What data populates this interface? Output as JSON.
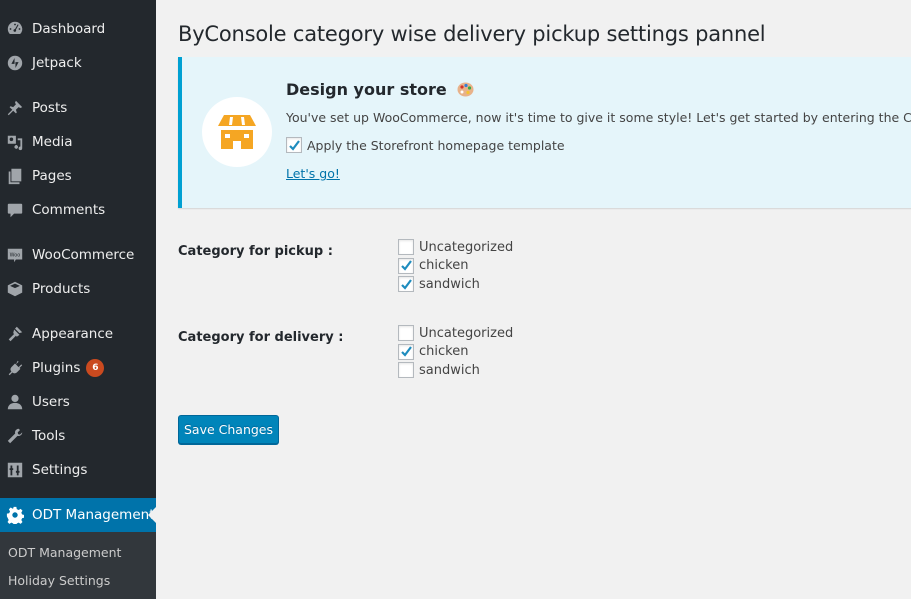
{
  "sidebar": {
    "items": [
      {
        "label": "Dashboard",
        "icon": "dashboard-icon"
      },
      {
        "label": "Jetpack",
        "icon": "jetpack-icon"
      },
      {
        "label": "Posts",
        "icon": "pin-icon"
      },
      {
        "label": "Media",
        "icon": "media-icon"
      },
      {
        "label": "Pages",
        "icon": "pages-icon"
      },
      {
        "label": "Comments",
        "icon": "comment-icon"
      },
      {
        "label": "WooCommerce",
        "icon": "woo-icon"
      },
      {
        "label": "Products",
        "icon": "box-icon"
      },
      {
        "label": "Appearance",
        "icon": "brush-icon"
      },
      {
        "label": "Plugins",
        "icon": "plug-icon",
        "badge": "6"
      },
      {
        "label": "Users",
        "icon": "user-icon"
      },
      {
        "label": "Tools",
        "icon": "wrench-icon"
      },
      {
        "label": "Settings",
        "icon": "sliders-icon"
      },
      {
        "label": "ODT Management",
        "icon": "gear-icon",
        "active": true
      }
    ],
    "submenu": [
      {
        "label": "ODT Management"
      },
      {
        "label": "Holiday Settings"
      }
    ]
  },
  "page": {
    "title": "ByConsole category wise delivery pickup settings pannel"
  },
  "notice": {
    "title": "Design your store",
    "text": "You've set up WooCommerce, now it's time to give it some style! Let's get started by entering the Customizer",
    "apply_label": "Apply the Storefront homepage template",
    "apply_checked": true,
    "link_label": "Let's go!",
    "accent_color": "#00a0d2"
  },
  "form": {
    "pickup": {
      "label": "Category for pickup :",
      "options": [
        {
          "label": "Uncategorized",
          "checked": false
        },
        {
          "label": "chicken",
          "checked": true
        },
        {
          "label": "sandwich",
          "checked": true
        }
      ]
    },
    "delivery": {
      "label": "Category for delivery :",
      "options": [
        {
          "label": "Uncategorized",
          "checked": false
        },
        {
          "label": "chicken",
          "checked": true
        },
        {
          "label": "sandwich",
          "checked": false
        }
      ]
    },
    "save_label": "Save Changes"
  }
}
